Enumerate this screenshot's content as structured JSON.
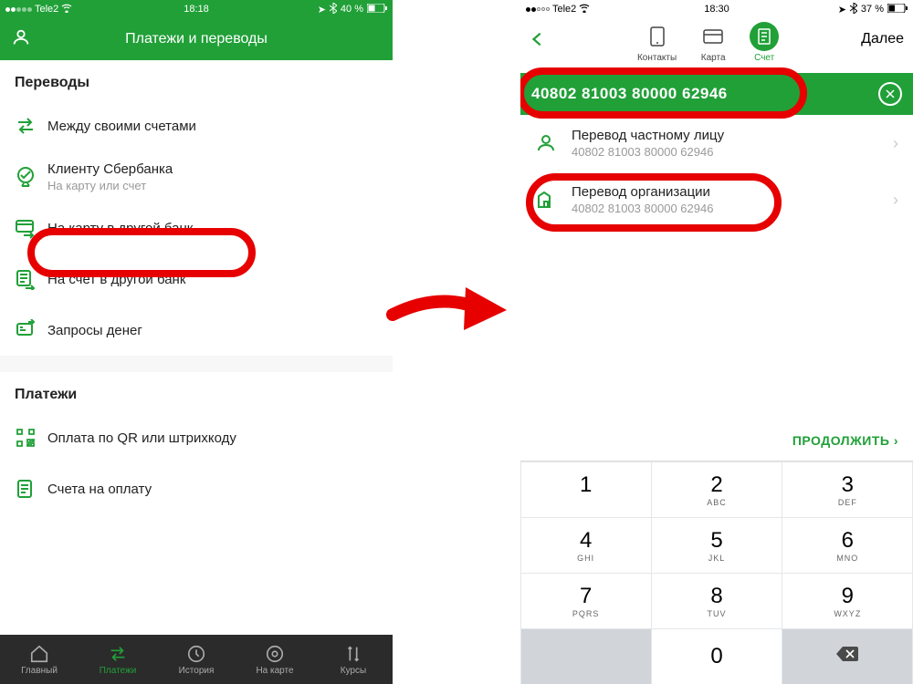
{
  "left": {
    "status": {
      "carrier": "Tele2",
      "time": "18:18",
      "battery": "40 %"
    },
    "header_title": "Платежи и переводы",
    "section_transfers": "Переводы",
    "section_payments": "Платежи",
    "rows": {
      "own": "Между своими счетами",
      "sber": "Клиенту Сбербанка",
      "sber_sub": "На карту или счет",
      "card": "На карту в другой банк",
      "acct": "На счет в другой банк",
      "req": "Запросы денег",
      "qr": "Оплата по QR или штрихкоду",
      "bills": "Счета на оплату"
    },
    "nav": {
      "home": "Главный",
      "pay": "Платежи",
      "hist": "История",
      "map": "На карте",
      "rates": "Курсы"
    }
  },
  "right": {
    "status": {
      "carrier": "Tele2",
      "time": "18:30",
      "battery": "37 %"
    },
    "next": "Далее",
    "tabs": {
      "contacts": "Контакты",
      "card": "Карта",
      "account": "Счет"
    },
    "account_value": "40802 81003 80000 62946",
    "results": {
      "person": "Перевод частному лицу",
      "person_sub": "40802 81003 80000 62946",
      "org": "Перевод организации",
      "org_sub": "40802 81003 80000 62946"
    },
    "continue": "ПРОДОЛЖИТЬ",
    "keypad": {
      "sub2": "ABC",
      "sub3": "DEF",
      "sub4": "GHI",
      "sub5": "JKL",
      "sub6": "MNO",
      "sub7": "PQRS",
      "sub8": "TUV",
      "sub9": "WXYZ"
    }
  }
}
